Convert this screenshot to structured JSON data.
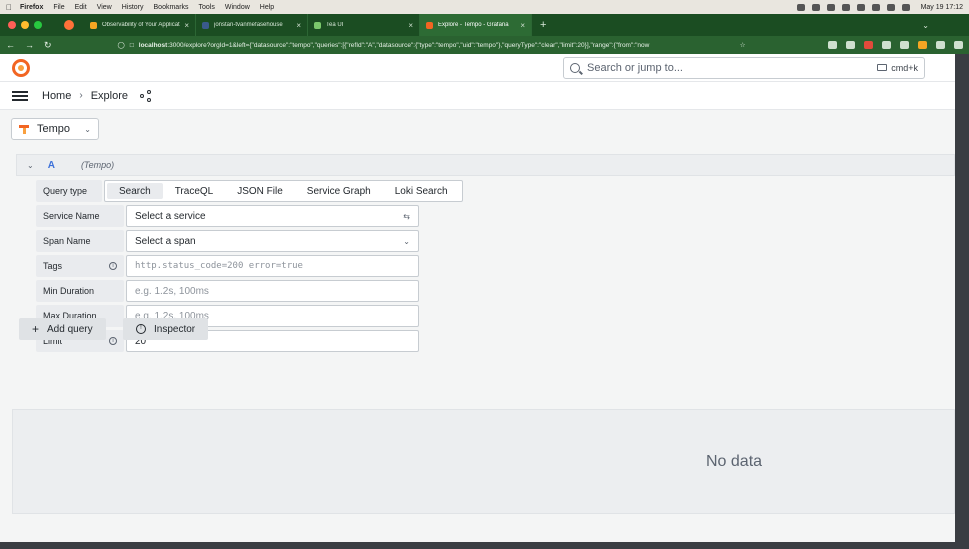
{
  "menubar": {
    "items": [
      "Firefox",
      "File",
      "Edit",
      "View",
      "History",
      "Bookmarks",
      "Tools",
      "Window",
      "Help"
    ],
    "clock": "May 19  17:12"
  },
  "browser": {
    "tabs": [
      {
        "label": "Observability of Your Applicati…",
        "color": "#f5a623"
      },
      {
        "label": "jonstan-tvanmefasehouse",
        "color": "#3a5a8c"
      },
      {
        "label": "Tea UI",
        "color": "#7bc86c"
      },
      {
        "label": "Explore - Tempo - Grafana",
        "color": "#f26522"
      }
    ],
    "url_host": "localhost",
    "url_rest": ":3000/explore?orgId=1&left={\"datasource\":\"tempo\",\"queries\":[{\"refId\":\"A\",\"datasource\":{\"type\":\"tempo\",\"uid\":\"tempo\"},\"queryType\":\"clear\",\"limit\":20}],\"range\":{\"from\":\"now"
  },
  "grafana": {
    "search_placeholder": "Search or jump to...",
    "search_shortcut": "cmd+k",
    "breadcrumb": {
      "home": "Home",
      "current": "Explore"
    },
    "datasource": "Tempo",
    "query": {
      "ref_id": "A",
      "ds_label": "(Tempo)",
      "query_type_label": "Query type",
      "query_types": [
        "Search",
        "TraceQL",
        "JSON File",
        "Service Graph",
        "Loki Search"
      ],
      "fields": {
        "service_name": {
          "label": "Service Name",
          "placeholder": "Select a service"
        },
        "span_name": {
          "label": "Span Name",
          "placeholder": "Select a span"
        },
        "tags": {
          "label": "Tags",
          "placeholder": "http.status_code=200 error=true"
        },
        "min_duration": {
          "label": "Min Duration",
          "placeholder": "e.g. 1.2s, 100ms"
        },
        "max_duration": {
          "label": "Max Duration",
          "placeholder": "e.g. 1.2s, 100ms"
        },
        "limit": {
          "label": "Limit",
          "value": "20"
        }
      }
    },
    "buttons": {
      "add_query": "Add query",
      "inspector": "Inspector"
    },
    "no_data": "No data"
  },
  "colors": {
    "tab_bar": "#1b4d22",
    "nav_bar": "#2a6230",
    "accent_orange": "#f26522",
    "ref_blue": "#3d71d9"
  }
}
